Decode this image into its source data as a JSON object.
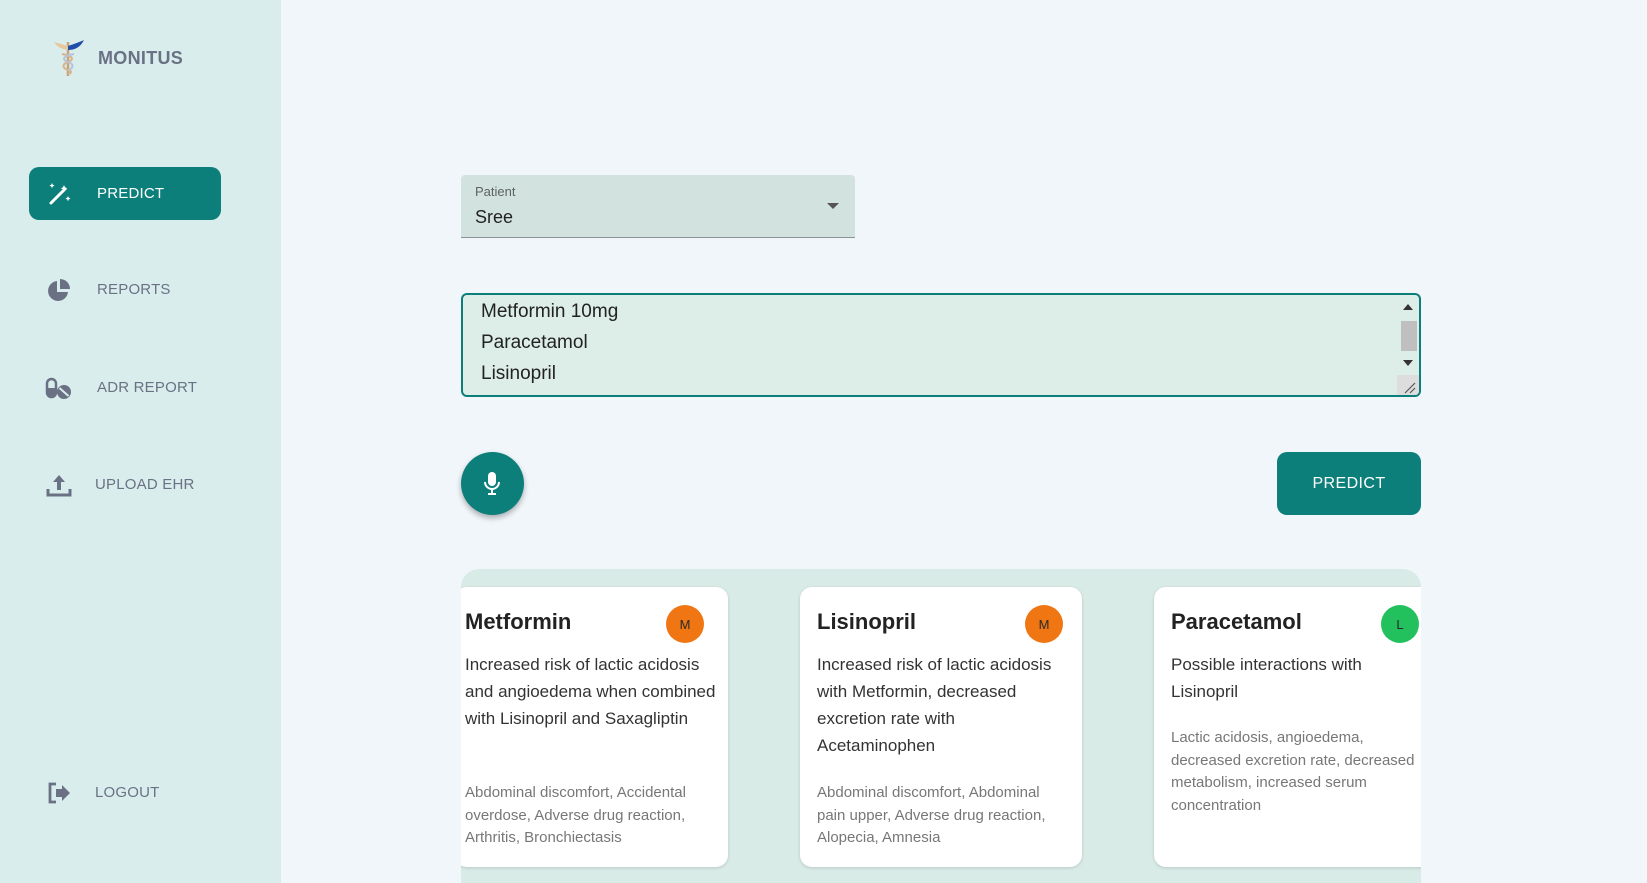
{
  "app": {
    "name": "MONITUS"
  },
  "sidebar": {
    "items": [
      {
        "label": "PREDICT",
        "icon": "magic-wand-icon",
        "active": true
      },
      {
        "label": "REPORTS",
        "icon": "pie-chart-icon",
        "active": false
      },
      {
        "label": "ADR REPORT",
        "icon": "pills-icon",
        "active": false
      },
      {
        "label": "UPLOAD EHR",
        "icon": "upload-icon",
        "active": false
      }
    ],
    "logout": {
      "label": "LOGOUT",
      "icon": "logout-icon"
    }
  },
  "form": {
    "patient_label": "Patient",
    "patient_value": "Sree",
    "medications": [
      "Metformin 10mg",
      "Paracetamol",
      "Lisinopril"
    ],
    "mic_icon": "microphone-icon",
    "predict_label": "PREDICT"
  },
  "results": [
    {
      "drug": "Metformin",
      "badge": "M",
      "badge_color": "#ef7613",
      "description": "Increased risk of lactic acidosis and angioedema when combined with Lisinopril and Saxagliptin",
      "effects": "Abdominal discomfort, Accidental overdose, Adverse drug reaction, Arthritis, Bronchiectasis"
    },
    {
      "drug": "Lisinopril",
      "badge": "M",
      "badge_color": "#ef7613",
      "description": "Increased risk of lactic acidosis with Metformin, decreased excretion rate with Acetaminophen",
      "effects": "Abdominal discomfort, Abdominal pain upper, Adverse drug reaction, Alopecia, Amnesia"
    },
    {
      "drug": "Paracetamol",
      "badge": "L",
      "badge_color": "#23c15d",
      "description": "Possible interactions with Lisinopril",
      "effects": "Lactic acidosis, angioedema, decreased excretion rate, decreased metabolism, increased serum concentration"
    }
  ],
  "colors": {
    "accent": "#0d7f7b",
    "sidebar_bg": "#d9eeec",
    "page_bg": "#f1f6fb"
  }
}
